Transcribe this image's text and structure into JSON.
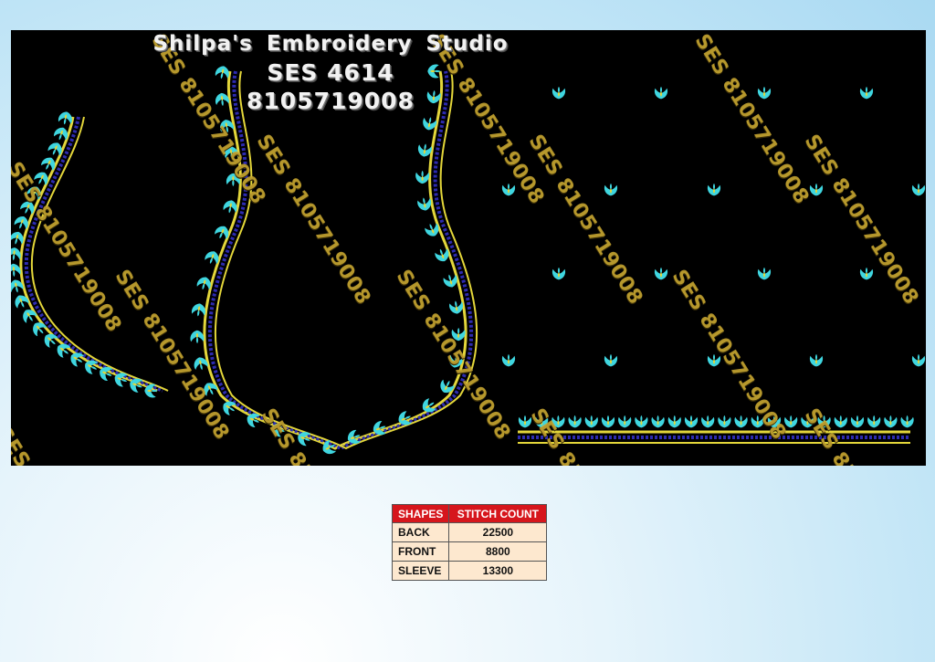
{
  "design": {
    "studio_name": "Shilpa's Embroidery Studio",
    "design_code": "SES 4614",
    "phone": "8105719008",
    "watermark_text": "SES 8105719008",
    "colors": {
      "background": "#000000",
      "motif": "#3fd6e0",
      "outline": "#e3d63a",
      "chain": "#2d2bb0"
    }
  },
  "stitch_table": {
    "headers": [
      "SHAPES",
      "STITCH COUNT"
    ],
    "rows": [
      {
        "shape": "BACK",
        "count": "22500"
      },
      {
        "shape": "FRONT",
        "count": "8800"
      },
      {
        "shape": "SLEEVE",
        "count": "13300"
      }
    ]
  }
}
